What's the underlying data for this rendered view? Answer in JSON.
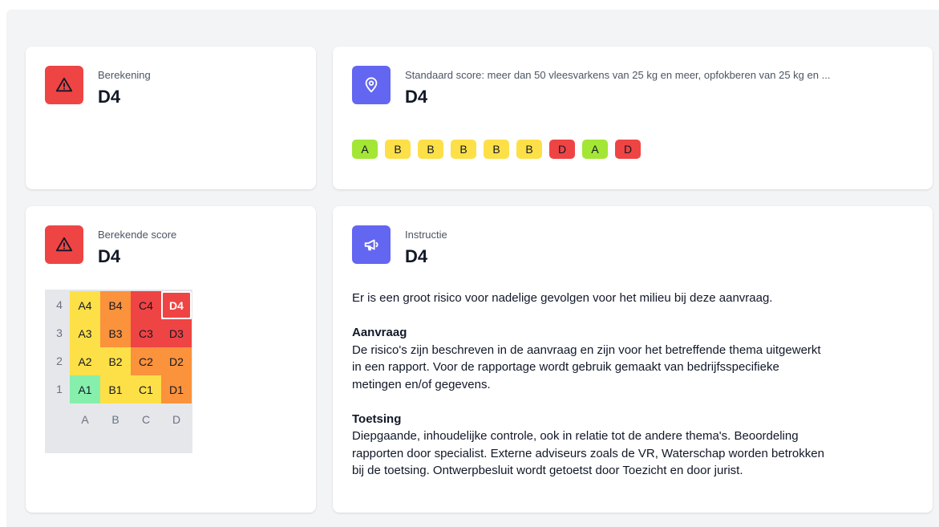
{
  "cards": {
    "berekening": {
      "label": "Berekening",
      "value": "D4",
      "icon": "warning-triangle-icon"
    },
    "standaard": {
      "label": "Standaard score: meer dan 50 vleesvarkens van 25 kg en meer, opfokberen van 25 kg en ...",
      "value": "D4",
      "icon": "location-pin-icon",
      "badges": [
        "A",
        "B",
        "B",
        "B",
        "B",
        "B",
        "D",
        "A",
        "D"
      ]
    },
    "berekende": {
      "label": "Berekende score",
      "value": "D4",
      "icon": "warning-triangle-icon",
      "matrix": {
        "rows": [
          {
            "label": "4",
            "cells": [
              "A4",
              "B4",
              "C4",
              "D4"
            ]
          },
          {
            "label": "3",
            "cells": [
              "A3",
              "B3",
              "C3",
              "D3"
            ]
          },
          {
            "label": "2",
            "cells": [
              "A2",
              "B2",
              "C2",
              "D2"
            ]
          },
          {
            "label": "1",
            "cells": [
              "A1",
              "B1",
              "C1",
              "D1"
            ]
          }
        ],
        "columns": [
          "A",
          "B",
          "C",
          "D"
        ],
        "selected": "D4"
      }
    },
    "instructie": {
      "label": "Instructie",
      "value": "D4",
      "icon": "megaphone-icon",
      "intro": "Er is een groot risico voor nadelige gevolgen voor het milieu bij deze aanvraag.",
      "sections": [
        {
          "heading": "Aanvraag",
          "lines": [
            "De risico's zijn beschreven in de aanvraag en zijn voor het betreffende thema uitgewerkt",
            "in een rapport. Voor de rapportage wordt gebruik gemaakt van bedrijfsspecifieke",
            "metingen en/of gegevens."
          ]
        },
        {
          "heading": "Toetsing",
          "lines": [
            "Diepgaande, inhoudelijke controle, ook in relatie tot de andere thema's. Beoordeling",
            "rapporten door specialist. Externe adviseurs zoals de VR, Waterschap worden betrokken",
            "bij de toetsing. Ontwerpbesluit wordt getoetst door Toezicht en door jurist."
          ]
        }
      ]
    }
  },
  "colors": {
    "danger": "#ef4444",
    "indigo": "#6366f1",
    "badge_A": "#a3e635",
    "badge_B": "#fde047",
    "badge_D": "#ef4444"
  }
}
